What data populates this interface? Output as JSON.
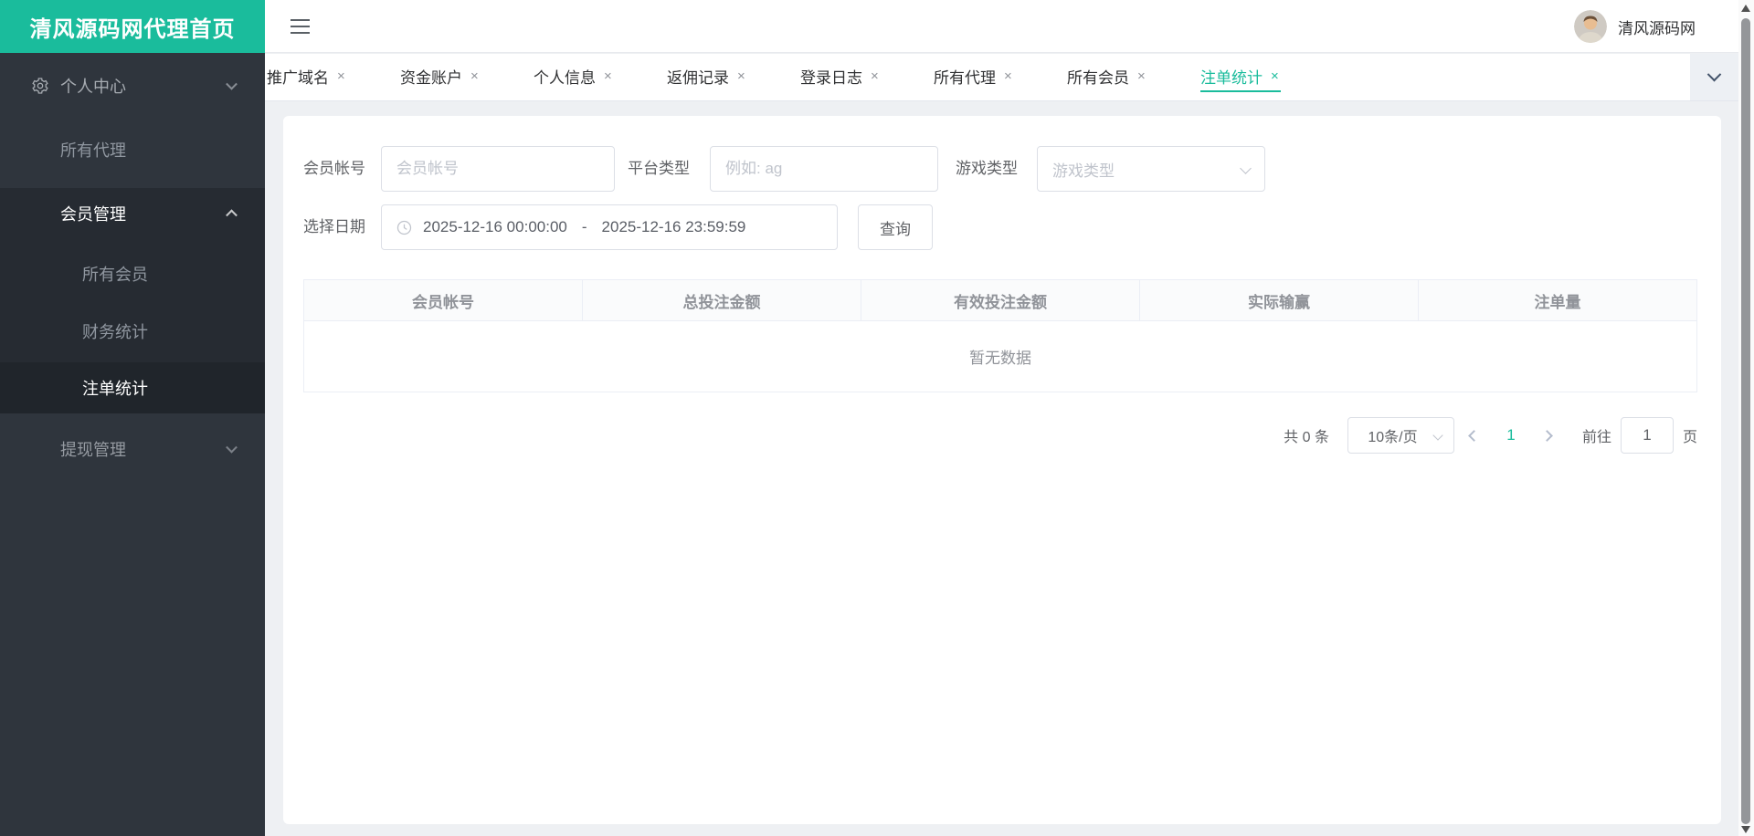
{
  "app": {
    "sidebar_title": "清风源码网代理首页",
    "user_name": "清风源码网"
  },
  "colors": {
    "accent": "#1abc9c",
    "sidebar_bg": "#2f353d",
    "sidebar_submenu_bg": "#262b32"
  },
  "icons": {
    "close": "×"
  },
  "sidebar": {
    "items": [
      {
        "label": "个人中心"
      },
      {
        "label": "所有代理"
      },
      {
        "label": "会员管理"
      },
      {
        "label": "所有会员"
      },
      {
        "label": "财务统计"
      },
      {
        "label": "注单统计"
      },
      {
        "label": "提现管理"
      }
    ]
  },
  "tabs": {
    "items": [
      "推广域名",
      "资金账户",
      "个人信息",
      "返佣记录",
      "登录日志",
      "所有代理",
      "所有会员",
      "注单统计"
    ],
    "active": "注单统计"
  },
  "filters": {
    "member_label": "会员帐号",
    "member_placeholder": "会员帐号",
    "platform_label": "平台类型",
    "platform_placeholder": "例如: ag",
    "game_label": "游戏类型",
    "game_placeholder": "游戏类型",
    "date_label": "选择日期",
    "date_start": "2025-12-16 00:00:00",
    "date_separator": "-",
    "date_end": "2025-12-16 23:59:59",
    "query_button": "查询"
  },
  "table": {
    "headers": [
      "会员帐号",
      "总投注金额",
      "有效投注金额",
      "实际输赢",
      "注单量"
    ],
    "rows": [],
    "empty_text": "暂无数据"
  },
  "pagination": {
    "total_text": "共 0 条",
    "page_size": "10条/页",
    "current_page": "1",
    "goto_label": "前往",
    "goto_value": "1",
    "page_unit": "页"
  }
}
